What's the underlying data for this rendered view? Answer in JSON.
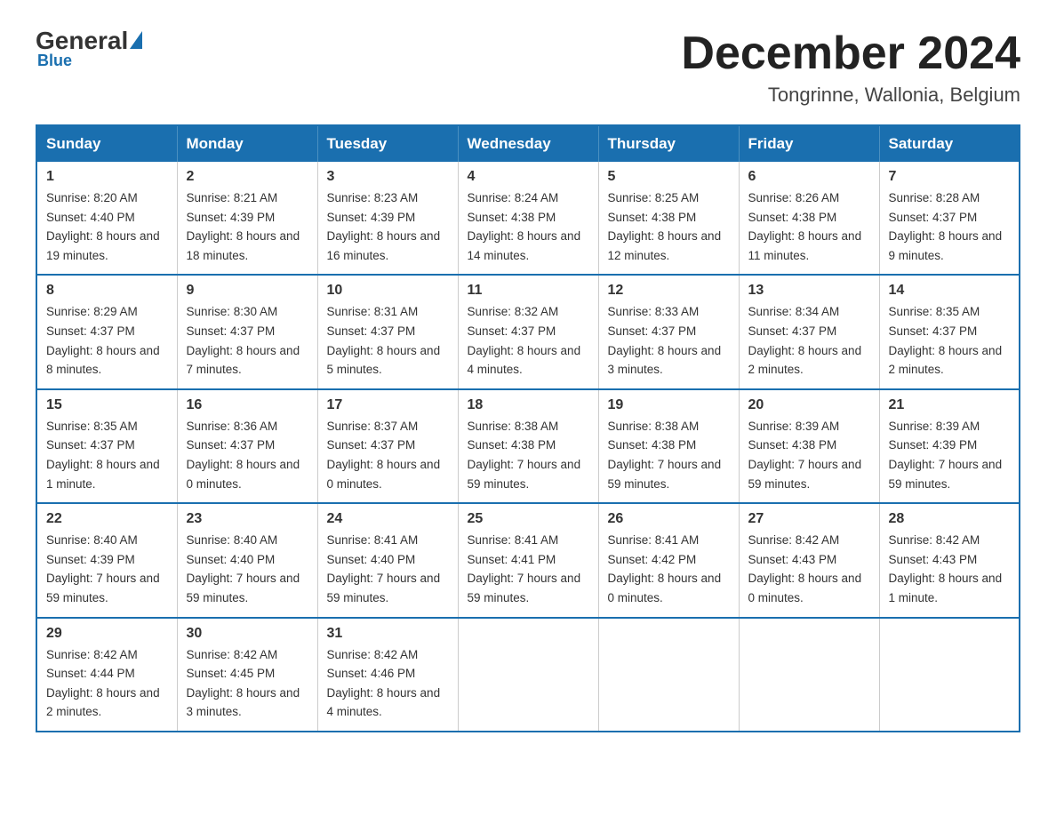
{
  "logo": {
    "general": "General",
    "blue": "Blue",
    "underline": "Blue"
  },
  "header": {
    "title": "December 2024",
    "location": "Tongrinne, Wallonia, Belgium"
  },
  "weekdays": [
    "Sunday",
    "Monday",
    "Tuesday",
    "Wednesday",
    "Thursday",
    "Friday",
    "Saturday"
  ],
  "weeks": [
    [
      {
        "day": "1",
        "sunrise": "8:20 AM",
        "sunset": "4:40 PM",
        "daylight": "8 hours and 19 minutes."
      },
      {
        "day": "2",
        "sunrise": "8:21 AM",
        "sunset": "4:39 PM",
        "daylight": "8 hours and 18 minutes."
      },
      {
        "day": "3",
        "sunrise": "8:23 AM",
        "sunset": "4:39 PM",
        "daylight": "8 hours and 16 minutes."
      },
      {
        "day": "4",
        "sunrise": "8:24 AM",
        "sunset": "4:38 PM",
        "daylight": "8 hours and 14 minutes."
      },
      {
        "day": "5",
        "sunrise": "8:25 AM",
        "sunset": "4:38 PM",
        "daylight": "8 hours and 12 minutes."
      },
      {
        "day": "6",
        "sunrise": "8:26 AM",
        "sunset": "4:38 PM",
        "daylight": "8 hours and 11 minutes."
      },
      {
        "day": "7",
        "sunrise": "8:28 AM",
        "sunset": "4:37 PM",
        "daylight": "8 hours and 9 minutes."
      }
    ],
    [
      {
        "day": "8",
        "sunrise": "8:29 AM",
        "sunset": "4:37 PM",
        "daylight": "8 hours and 8 minutes."
      },
      {
        "day": "9",
        "sunrise": "8:30 AM",
        "sunset": "4:37 PM",
        "daylight": "8 hours and 7 minutes."
      },
      {
        "day": "10",
        "sunrise": "8:31 AM",
        "sunset": "4:37 PM",
        "daylight": "8 hours and 5 minutes."
      },
      {
        "day": "11",
        "sunrise": "8:32 AM",
        "sunset": "4:37 PM",
        "daylight": "8 hours and 4 minutes."
      },
      {
        "day": "12",
        "sunrise": "8:33 AM",
        "sunset": "4:37 PM",
        "daylight": "8 hours and 3 minutes."
      },
      {
        "day": "13",
        "sunrise": "8:34 AM",
        "sunset": "4:37 PM",
        "daylight": "8 hours and 2 minutes."
      },
      {
        "day": "14",
        "sunrise": "8:35 AM",
        "sunset": "4:37 PM",
        "daylight": "8 hours and 2 minutes."
      }
    ],
    [
      {
        "day": "15",
        "sunrise": "8:35 AM",
        "sunset": "4:37 PM",
        "daylight": "8 hours and 1 minute."
      },
      {
        "day": "16",
        "sunrise": "8:36 AM",
        "sunset": "4:37 PM",
        "daylight": "8 hours and 0 minutes."
      },
      {
        "day": "17",
        "sunrise": "8:37 AM",
        "sunset": "4:37 PM",
        "daylight": "8 hours and 0 minutes."
      },
      {
        "day": "18",
        "sunrise": "8:38 AM",
        "sunset": "4:38 PM",
        "daylight": "7 hours and 59 minutes."
      },
      {
        "day": "19",
        "sunrise": "8:38 AM",
        "sunset": "4:38 PM",
        "daylight": "7 hours and 59 minutes."
      },
      {
        "day": "20",
        "sunrise": "8:39 AM",
        "sunset": "4:38 PM",
        "daylight": "7 hours and 59 minutes."
      },
      {
        "day": "21",
        "sunrise": "8:39 AM",
        "sunset": "4:39 PM",
        "daylight": "7 hours and 59 minutes."
      }
    ],
    [
      {
        "day": "22",
        "sunrise": "8:40 AM",
        "sunset": "4:39 PM",
        "daylight": "7 hours and 59 minutes."
      },
      {
        "day": "23",
        "sunrise": "8:40 AM",
        "sunset": "4:40 PM",
        "daylight": "7 hours and 59 minutes."
      },
      {
        "day": "24",
        "sunrise": "8:41 AM",
        "sunset": "4:40 PM",
        "daylight": "7 hours and 59 minutes."
      },
      {
        "day": "25",
        "sunrise": "8:41 AM",
        "sunset": "4:41 PM",
        "daylight": "7 hours and 59 minutes."
      },
      {
        "day": "26",
        "sunrise": "8:41 AM",
        "sunset": "4:42 PM",
        "daylight": "8 hours and 0 minutes."
      },
      {
        "day": "27",
        "sunrise": "8:42 AM",
        "sunset": "4:43 PM",
        "daylight": "8 hours and 0 minutes."
      },
      {
        "day": "28",
        "sunrise": "8:42 AM",
        "sunset": "4:43 PM",
        "daylight": "8 hours and 1 minute."
      }
    ],
    [
      {
        "day": "29",
        "sunrise": "8:42 AM",
        "sunset": "4:44 PM",
        "daylight": "8 hours and 2 minutes."
      },
      {
        "day": "30",
        "sunrise": "8:42 AM",
        "sunset": "4:45 PM",
        "daylight": "8 hours and 3 minutes."
      },
      {
        "day": "31",
        "sunrise": "8:42 AM",
        "sunset": "4:46 PM",
        "daylight": "8 hours and 4 minutes."
      },
      null,
      null,
      null,
      null
    ]
  ]
}
